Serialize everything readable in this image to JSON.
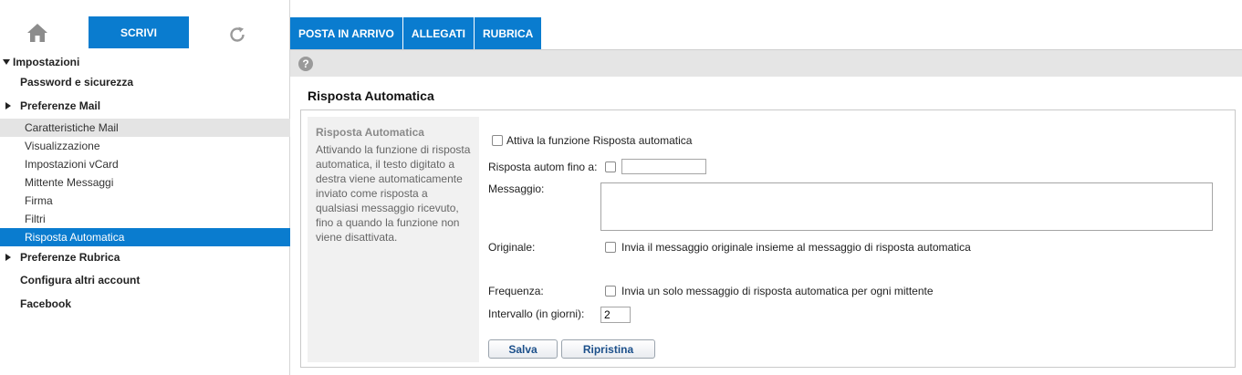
{
  "top": {
    "compose_label": "SCRIVI"
  },
  "icons": {
    "home": "home-icon",
    "refresh": "refresh-icon",
    "help": "help-icon"
  },
  "colors": {
    "accent": "#0a7ccf",
    "highlight": "#e4e4e4",
    "help_bar": "#e5e5e5"
  },
  "sidebar": {
    "settings_label": "Impostazioni",
    "password_label": "Password e sicurezza",
    "mail_prefs_label": "Preferenze Mail",
    "mail_items": [
      {
        "label": "Caratteristiche Mail"
      },
      {
        "label": "Visualizzazione"
      },
      {
        "label": "Impostazioni vCard"
      },
      {
        "label": "Mittente Messaggi"
      },
      {
        "label": "Firma"
      },
      {
        "label": "Filtri"
      },
      {
        "label": "Risposta Automatica"
      }
    ],
    "rubrica_prefs_label": "Preferenze Rubrica",
    "other_accounts_label": "Configura altri account",
    "facebook_label": "Facebook"
  },
  "tabs": [
    {
      "label": "POSTA IN ARRIVO"
    },
    {
      "label": "ALLEGATI"
    },
    {
      "label": "RUBRICA"
    }
  ],
  "help_glyph": "?",
  "page_title": "Risposta Automatica",
  "description": {
    "title": "Risposta Automatica",
    "text": "Attivando la funzione di risposta automatica, il testo digitato a destra viene automaticamente inviato come risposta a qualsiasi messaggio ricevuto, fino a quando la funzione non viene disattivata."
  },
  "form": {
    "enable_label": "Attiva la funzione Risposta automatica",
    "until_label": "Risposta autom fino a:",
    "until_value": "",
    "message_label": "Messaggio:",
    "message_value": "",
    "original_label": "Originale:",
    "original_option": "Invia il messaggio originale insieme al messaggio di risposta automatica",
    "frequency_label": "Frequenza:",
    "frequency_option": "Invia un solo messaggio di risposta automatica per ogni mittente",
    "interval_label": "Intervallo (in giorni):",
    "interval_value": "2",
    "save_label": "Salva",
    "reset_label": "Ripristina"
  }
}
